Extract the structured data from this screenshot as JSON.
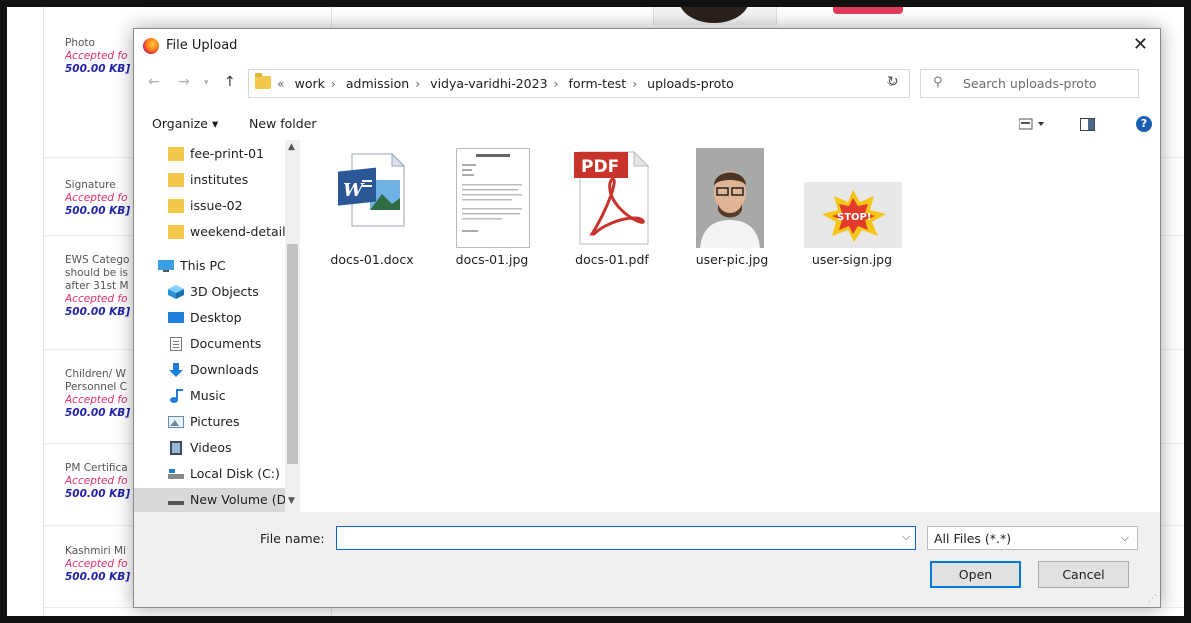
{
  "background_page": {
    "fields": [
      {
        "label": "Photo",
        "accepted": "Accepted fo",
        "size": "500.00 KB]"
      },
      {
        "label": "Signature",
        "accepted": "Accepted fo",
        "size": "500.00 KB]"
      },
      {
        "label_lines": [
          "EWS Catego",
          "should be is",
          "after 31st M"
        ],
        "accepted": "Accepted fo",
        "size": "500.00 KB]"
      },
      {
        "label_lines": [
          "Children/ W",
          "Personnel C"
        ],
        "accepted": "Accepted fo",
        "size": "500.00 KB]"
      },
      {
        "label": "PM Certifica",
        "accepted": "Accepted fo",
        "size": "500.00 KB]"
      },
      {
        "label": "Kashmiri Mi",
        "accepted": "Accepted fo",
        "size": "500.00 KB]"
      }
    ]
  },
  "dialog": {
    "title": "File Upload",
    "close_glyph": "✕",
    "breadcrumb": {
      "prefix": "«",
      "parts": [
        "work",
        "admission",
        "vidya-varidhi-2023",
        "form-test",
        "uploads-proto"
      ],
      "separator": "›"
    },
    "search_placeholder": "Search uploads-proto",
    "toolbar": {
      "organize_label": "Organize ▾",
      "new_folder_label": "New folder",
      "help_glyph": "?"
    },
    "nav_items": [
      {
        "label": "fee-print-01",
        "icon": "folder-icon"
      },
      {
        "label": "institutes",
        "icon": "folder-icon"
      },
      {
        "label": "issue-02",
        "icon": "folder-icon"
      },
      {
        "label": "weekend-details",
        "icon": "folder-icon"
      },
      {
        "label": "This PC",
        "icon": "pc-icon"
      },
      {
        "label": "3D Objects",
        "icon": "cube-icon"
      },
      {
        "label": "Desktop",
        "icon": "desktop-icon"
      },
      {
        "label": "Documents",
        "icon": "documents-icon"
      },
      {
        "label": "Downloads",
        "icon": "downloads-icon"
      },
      {
        "label": "Music",
        "icon": "music-icon"
      },
      {
        "label": "Pictures",
        "icon": "pictures-icon"
      },
      {
        "label": "Videos",
        "icon": "videos-icon"
      },
      {
        "label": "Local Disk (C:)",
        "icon": "disk-icon"
      },
      {
        "label": "New Volume (D:)",
        "icon": "drive-icon"
      }
    ],
    "files": [
      {
        "name": "docs-01.docx",
        "icon": "word-doc-icon"
      },
      {
        "name": "docs-01.jpg",
        "icon": "document-thumbnail"
      },
      {
        "name": "docs-01.pdf",
        "icon": "pdf-icon"
      },
      {
        "name": "user-pic.jpg",
        "icon": "portrait-thumbnail"
      },
      {
        "name": "user-sign.jpg",
        "icon": "stop-sticker-thumbnail"
      }
    ],
    "file_name_label": "File name:",
    "file_name_value": "",
    "file_type": "All Files (*.*)",
    "open_label": "Open",
    "cancel_label": "Cancel"
  },
  "colors": {
    "accent": "#0078d7",
    "selection": "#cce8ff",
    "accepted_text": "#e0306a",
    "size_text": "#2222aa"
  }
}
